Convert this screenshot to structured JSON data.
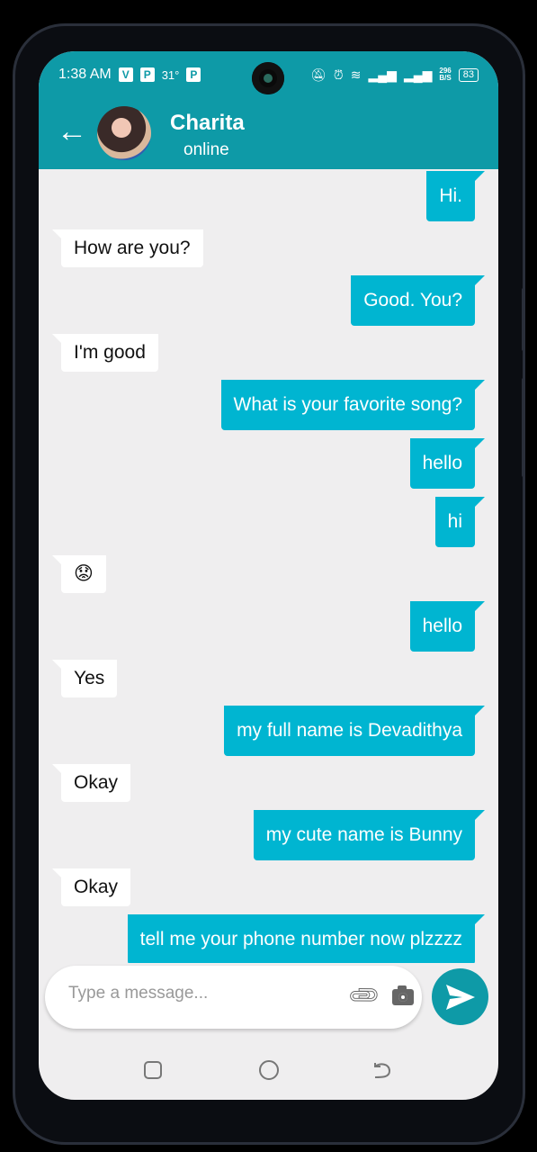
{
  "status_bar": {
    "time": "1:38 AM",
    "temperature": "31°",
    "net_speed": "296",
    "net_unit": "B/S",
    "battery": "83"
  },
  "header": {
    "contact_name": "Charita",
    "status": "online"
  },
  "messages": [
    {
      "side": "sent",
      "text": "Hi."
    },
    {
      "side": "recv",
      "text": "How are you?"
    },
    {
      "side": "sent",
      "text": "Good. You?"
    },
    {
      "side": "recv",
      "text": "I'm good"
    },
    {
      "side": "sent",
      "text": "What is your favorite song?"
    },
    {
      "side": "sent",
      "text": "hello"
    },
    {
      "side": "sent",
      "text": "hi"
    },
    {
      "side": "recv",
      "text": "😟"
    },
    {
      "side": "sent",
      "text": "hello"
    },
    {
      "side": "recv",
      "text": "Yes"
    },
    {
      "side": "sent",
      "text": "my full name is Devadithya"
    },
    {
      "side": "recv",
      "text": "Okay"
    },
    {
      "side": "sent",
      "text": "my cute name is Bunny"
    },
    {
      "side": "recv",
      "text": "Okay"
    },
    {
      "side": "sent",
      "text": "tell me your phone number now plzzzz"
    }
  ],
  "composer": {
    "placeholder": "Type a message...",
    "value": ""
  },
  "colors": {
    "header": "#0e9aa7",
    "sent_bubble": "#00b5d1",
    "received_bubble": "#ffffff",
    "chat_bg": "#efeeef"
  }
}
